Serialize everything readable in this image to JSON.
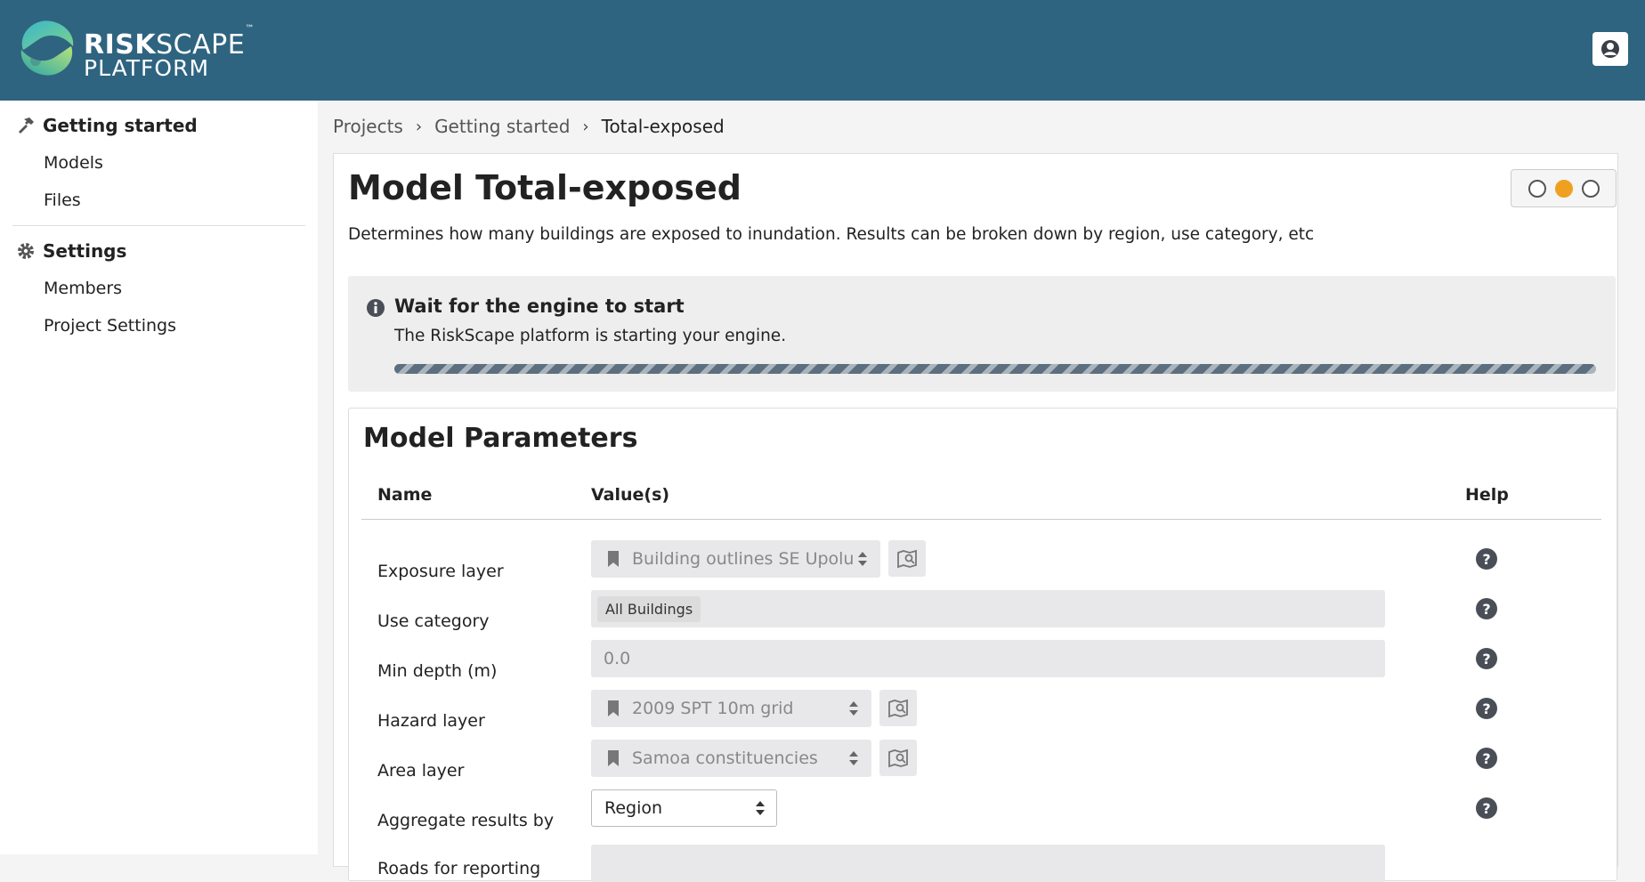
{
  "header": {
    "brand_bold": "RISK",
    "brand_rest": "SCAPE",
    "brand_tm": "™",
    "brand_line2": "PLATFORM",
    "user_icon": "user-icon"
  },
  "sidebar": {
    "sections": [
      {
        "label": "Getting started",
        "icon": "hammer-icon",
        "items": [
          "Models",
          "Files"
        ]
      },
      {
        "label": "Settings",
        "icon": "gear-icon",
        "items": [
          "Members",
          "Project Settings"
        ]
      }
    ]
  },
  "breadcrumb": [
    "Projects",
    "Getting started",
    "Total-exposed"
  ],
  "model": {
    "title": "Model Total-exposed",
    "description": "Determines how many buildings are exposed to inundation. Results can be broken down by region, use category, etc",
    "status_dots": [
      "off",
      "on",
      "off"
    ]
  },
  "notice": {
    "heading": "Wait for the engine to start",
    "text": "The RiskScape platform is starting your engine."
  },
  "params": {
    "heading": "Model Parameters",
    "columns": {
      "name": "Name",
      "value": "Value(s)",
      "help": "Help"
    },
    "rows": [
      {
        "label": "Exposure layer",
        "value": "Building outlines SE Upolu"
      },
      {
        "label": "Use category",
        "chip": "All Buildings"
      },
      {
        "label": "Min depth (m)",
        "value": "0.0"
      },
      {
        "label": "Hazard layer",
        "value": "2009 SPT 10m grid"
      },
      {
        "label": "Area layer",
        "value": "Samoa constituencies"
      },
      {
        "label": "Aggregate results by",
        "value": "Region"
      },
      {
        "label": "Roads for reporting"
      }
    ],
    "help_glyph": "?"
  }
}
